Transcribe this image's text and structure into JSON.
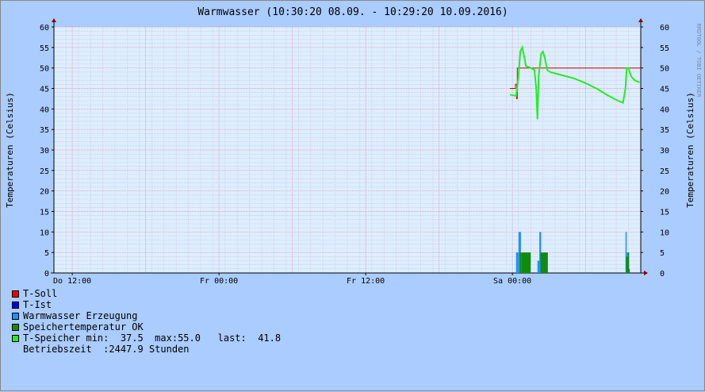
{
  "chart_data": {
    "type": "line",
    "title": "Warmwasser (10:30:20 08.09. - 10:29:20 10.09.2016)",
    "ylabel": "Temperaturen (Celsius)",
    "ylabel_right": "Temperaturen (Celsius)",
    "watermark": "RRDTOOL / TOBI OETIKER",
    "ylim": [
      0,
      60
    ],
    "yticks": [
      "0",
      "5",
      "10",
      "15",
      "20",
      "25",
      "30",
      "35",
      "40",
      "45",
      "50",
      "55",
      "60"
    ],
    "xlim_hours": [
      0,
      48
    ],
    "xticks": [
      {
        "label": "Do 12:00",
        "t": 1.5
      },
      {
        "label": "Fr 00:00",
        "t": 13.5
      },
      {
        "label": "Fr 12:00",
        "t": 25.5
      },
      {
        "label": "Sa 00:00",
        "t": 37.5
      }
    ],
    "grid": true,
    "colors": {
      "background": "#aaccff",
      "plot": "#ddeeff",
      "grid": "#ccbbdd",
      "major_grid": "#dd88aa",
      "t_soll": "#cc0000",
      "t_ist": "#0000ee",
      "warmwasser_erzeugung": "#1e90ff",
      "speichertemperatur_ok": "#0e8c0e",
      "t_speicher": "#22ee22"
    },
    "series": [
      {
        "name": "T-Soll",
        "color": "#cc0000",
        "points": [
          [
            37.3,
            45
          ],
          [
            37.75,
            45
          ],
          [
            37.75,
            46
          ],
          [
            37.85,
            46
          ],
          [
            37.85,
            42.5
          ],
          [
            37.9,
            42.5
          ],
          [
            37.9,
            50
          ],
          [
            48,
            50
          ]
        ]
      },
      {
        "name": "T-Speicher",
        "color": "#22ee22",
        "points": [
          [
            37.3,
            43.5
          ],
          [
            37.8,
            43.2
          ],
          [
            38.0,
            48
          ],
          [
            38.15,
            54
          ],
          [
            38.3,
            55
          ],
          [
            38.45,
            53
          ],
          [
            38.6,
            50.5
          ],
          [
            39.0,
            50
          ],
          [
            39.3,
            49.5
          ],
          [
            39.45,
            45
          ],
          [
            39.55,
            37.5
          ],
          [
            39.65,
            48
          ],
          [
            39.85,
            53.5
          ],
          [
            40.0,
            54
          ],
          [
            40.15,
            52.5
          ],
          [
            40.35,
            49.5
          ],
          [
            40.6,
            49
          ],
          [
            41.5,
            48.3
          ],
          [
            42.5,
            47.5
          ],
          [
            43.5,
            46.3
          ],
          [
            44.5,
            44.8
          ],
          [
            45.2,
            43.5
          ],
          [
            45.8,
            42.5
          ],
          [
            46.3,
            41.8
          ],
          [
            46.55,
            41.5
          ],
          [
            46.75,
            45
          ],
          [
            46.85,
            50
          ],
          [
            47.0,
            50
          ],
          [
            47.2,
            48
          ],
          [
            47.5,
            47
          ],
          [
            47.9,
            46.5
          ],
          [
            48.3,
            45
          ],
          [
            48.6,
            43
          ],
          [
            48.85,
            41.5
          ],
          [
            49.2,
            41.8
          ],
          [
            49.6,
            41.5
          ],
          [
            50.0,
            41.8
          ]
        ]
      },
      {
        "name": "Warmwasser Erzeugung",
        "color": "#1e90ff",
        "bars": [
          [
            37.8,
            38.0,
            5
          ],
          [
            38.0,
            38.2,
            10
          ],
          [
            39.55,
            39.7,
            3
          ],
          [
            39.7,
            39.85,
            10
          ],
          [
            46.75,
            46.85,
            10
          ],
          [
            46.85,
            47.0,
            5
          ]
        ]
      },
      {
        "name": "Speichertemperatur OK",
        "color": "#0e8c0e",
        "bars": [
          [
            38.1,
            38.25,
            5
          ],
          [
            38.25,
            39.0,
            5
          ],
          [
            38.35,
            38.85,
            3.5
          ],
          [
            39.8,
            40.4,
            5
          ],
          [
            46.8,
            46.95,
            4
          ],
          [
            46.95,
            47.05,
            5
          ],
          [
            47.0,
            47.1,
            1
          ]
        ]
      }
    ]
  },
  "legend": [
    {
      "label": "T-Soll",
      "color": "#ee0000"
    },
    {
      "label": "T-Ist",
      "color": "#0000ee"
    },
    {
      "label": "Warmwasser Erzeugung",
      "color": "#1e90ff"
    },
    {
      "label": "Speichertemperatur OK",
      "color": "#0e8c0e"
    },
    {
      "label": "T-Speicher min:  37.5  max:55.0   last:  41.8",
      "color": "#22ee22"
    },
    {
      "label": "Betriebszeit  :2447.9 Stunden",
      "color": ""
    }
  ]
}
